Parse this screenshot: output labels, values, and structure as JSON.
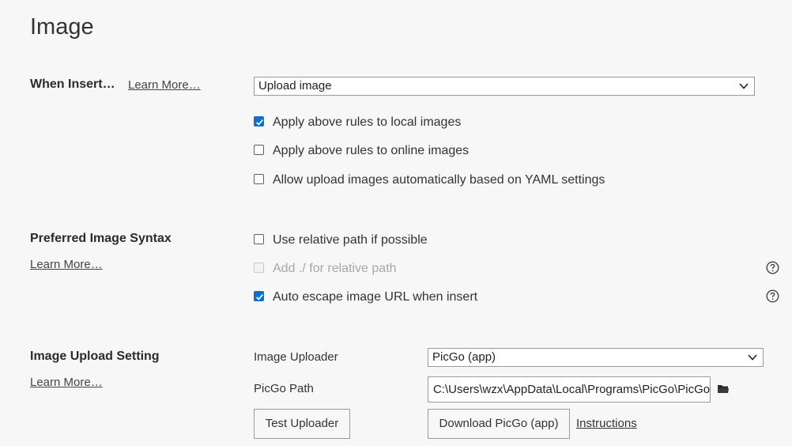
{
  "page": {
    "title": "Image"
  },
  "when_insert": {
    "label": "When Insert…",
    "learn_more": "Learn More…",
    "selected": "Upload image",
    "options": [
      {
        "label": "Apply above rules to local images",
        "checked": true,
        "disabled": false
      },
      {
        "label": "Apply above rules to online images",
        "checked": false,
        "disabled": false
      },
      {
        "label": "Allow upload images automatically based on YAML settings",
        "checked": false,
        "disabled": false
      }
    ]
  },
  "preferred_syntax": {
    "label": "Preferred Image Syntax",
    "learn_more": "Learn More…",
    "options": [
      {
        "label": "Use relative path if possible",
        "checked": false,
        "disabled": false,
        "help": false
      },
      {
        "label": "Add ./ for relative path",
        "checked": false,
        "disabled": true,
        "help": true
      },
      {
        "label": "Auto escape image URL when insert",
        "checked": true,
        "disabled": false,
        "help": true
      }
    ]
  },
  "upload_setting": {
    "label": "Image Upload Setting",
    "learn_more": "Learn More…",
    "uploader_label": "Image Uploader",
    "uploader_value": "PicGo (app)",
    "path_label": "PicGo Path",
    "path_value": "C:\\Users\\wzx\\AppData\\Local\\Programs\\PicGo\\PicGo.exe",
    "test_button": "Test Uploader",
    "download_button": "Download PicGo (app)",
    "instructions_link": "Instructions"
  },
  "icons": {
    "chevron": "chevron-down-icon",
    "check": "checkmark-icon",
    "help": "question-circle-icon",
    "folder": "folder-icon"
  },
  "colors": {
    "accent": "#0f6fcf",
    "background": "#f7f7f7",
    "border": "#9a9a9a",
    "disabled_text": "#a6a6a6"
  }
}
